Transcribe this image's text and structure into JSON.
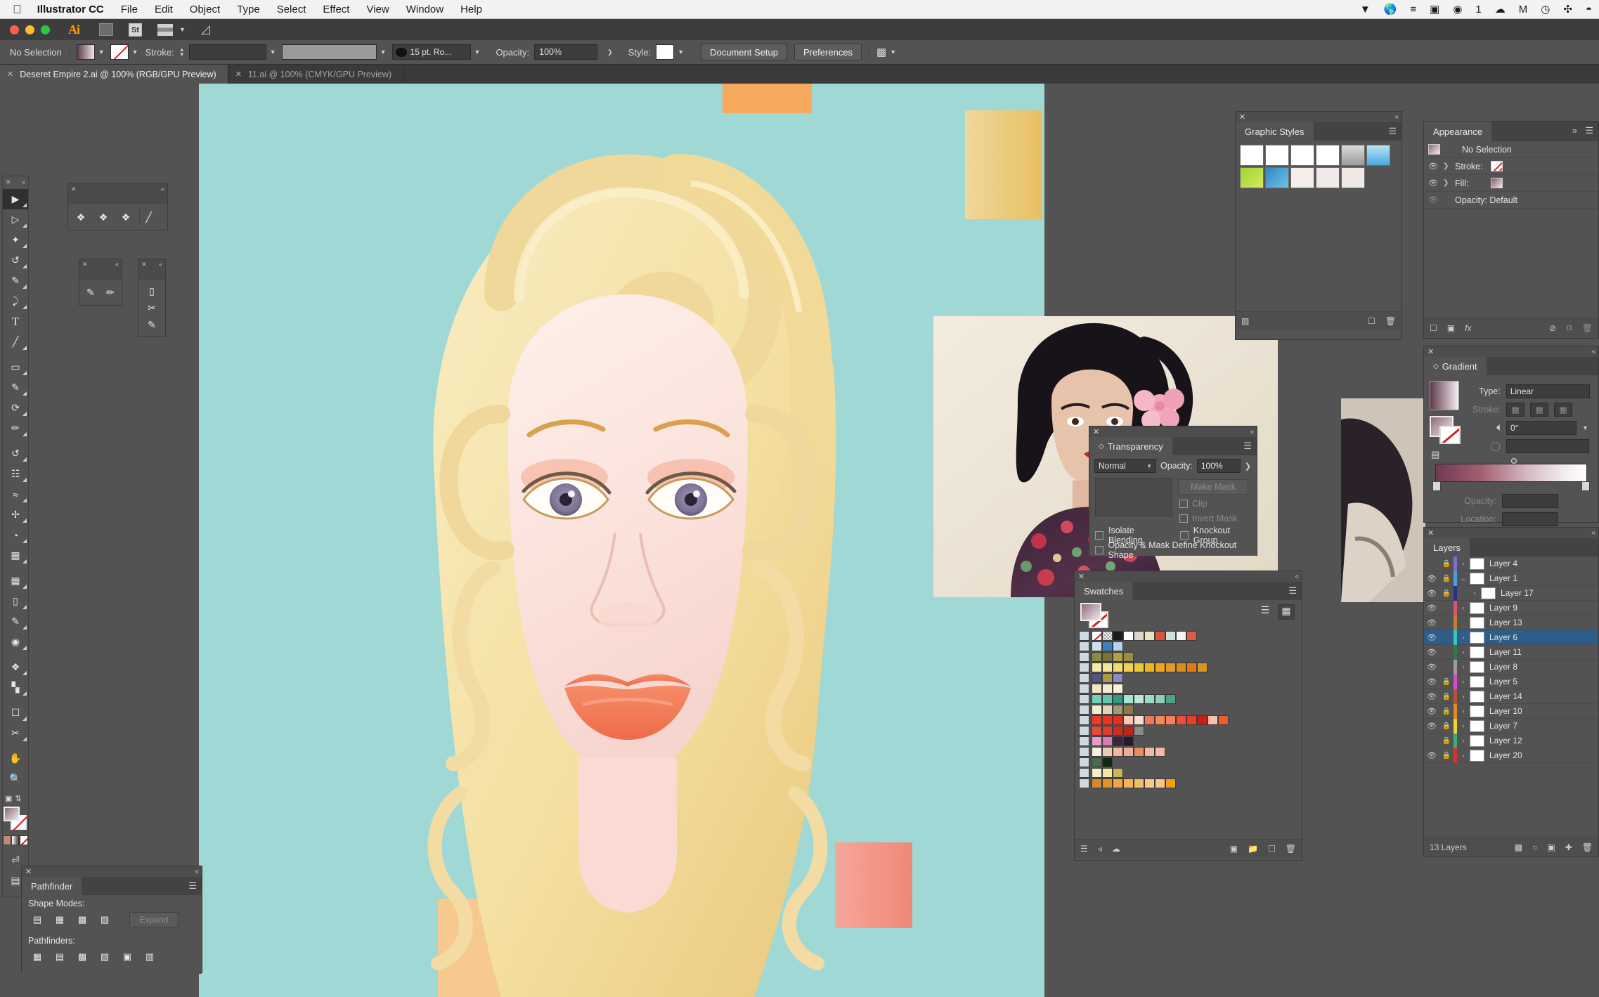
{
  "menubar": {
    "apple": "",
    "app_name": "Illustrator CC",
    "items": [
      "File",
      "Edit",
      "Object",
      "Type",
      "Select",
      "Effect",
      "View",
      "Window",
      "Help"
    ],
    "status_items": [
      "dropbox-icon",
      "globe-icon",
      "list-icon",
      "display-icon",
      "chat-icon",
      "1",
      "cloud-icon",
      "m-icon",
      "clock-icon",
      "bluetooth-icon",
      "wifi-icon"
    ],
    "chat_count": "1"
  },
  "appbar": {
    "logo": "Ai",
    "icons": [
      "bridge-icon",
      "stock-icon",
      "arrange-documents-icon",
      "chevron-down-icon",
      "workspace-icon"
    ]
  },
  "controlbar": {
    "selection_status": "No Selection",
    "fill_label": "fill-swatch",
    "stroke_swatch_label": "stroke-swatch",
    "stroke_label": "Stroke:",
    "stroke_weight": "",
    "stroke_profile": "",
    "brush_label": "15 pt. Ro...",
    "opacity_label": "Opacity:",
    "opacity_value": "100%",
    "style_label": "Style:",
    "document_setup": "Document Setup",
    "preferences": "Preferences",
    "align_label": "align-icon"
  },
  "tabs": [
    {
      "label": "Deseret Empire 2.ai @ 100% (RGB/GPU Preview)",
      "active": true
    },
    {
      "label": "11.ai @ 100% (CMYK/GPU Preview)",
      "active": false
    }
  ],
  "toolbar": {
    "tools": [
      "selection-tool",
      "direct-selection-tool",
      "magic-wand-tool",
      "lasso-tool",
      "pen-tool",
      "curvature-tool",
      "type-tool",
      "line-segment-tool",
      "rectangle-tool",
      "paintbrush-tool",
      "shaper-tool",
      "pencil-tool",
      "blob-brush-tool",
      "eraser-tool",
      "rotate-tool",
      "scale-tool",
      "width-tool",
      "free-transform-tool",
      "shape-builder-tool",
      "perspective-grid-tool",
      "mesh-tool",
      "gradient-tool",
      "eyedropper-tool",
      "blend-tool",
      "symbol-sprayer-tool",
      "column-graph-tool",
      "artboard-tool",
      "slice-tool",
      "hand-tool",
      "zoom-tool"
    ],
    "fill_stroke": "fill-stroke-swatches",
    "color_modes": [
      "color-mode",
      "gradient-mode",
      "none-mode"
    ]
  },
  "mini_panels": [
    {
      "name": "symbolism-tools",
      "buttons": [
        "symbol-sprayer",
        "symbol-shifter",
        "symbol-scruncher",
        "symbol-sizer"
      ]
    },
    {
      "name": "brush-tools",
      "buttons": [
        "paintbrush",
        "blob-brush"
      ]
    },
    {
      "name": "eraser-tools",
      "buttons": [
        "eraser",
        "scissors",
        "knife"
      ]
    }
  ],
  "graphic_styles": {
    "title": "Graphic Styles",
    "swatch_count": 12,
    "footer_icons": [
      "break-link-icon",
      "new-style-icon",
      "delete-icon"
    ]
  },
  "appearance": {
    "title": "Appearance",
    "target": "No Selection",
    "rows": [
      {
        "label": "Stroke:",
        "eye": true,
        "arrow": true,
        "swatch": "none"
      },
      {
        "label": "Fill:",
        "eye": true,
        "arrow": true,
        "swatch": "gradient"
      }
    ],
    "opacity_row": "Opacity: Default",
    "footer_icons": [
      "add-new-stroke-icon",
      "add-new-fill-icon",
      "add-effect-icon",
      "clear-appearance-icon",
      "duplicate-item-icon",
      "delete-item-icon"
    ]
  },
  "gradient": {
    "title": "Gradient",
    "type_label": "Type:",
    "type_value": "Linear",
    "stroke_label": "Stroke:",
    "angle_label": "angle-icon",
    "angle_value": "0°",
    "aspect_label": "aspect-ratio-icon",
    "aspect_value": "",
    "opacity_label": "Opacity:",
    "opacity_value": "",
    "location_label": "Location:",
    "location_value": "",
    "stops": [
      "#6d3a52",
      "#ffffff"
    ]
  },
  "layers_panel": {
    "title": "Layers",
    "count_label": "13 Layers",
    "footer_icons": [
      "make-clipping-mask-icon",
      "create-new-sublayer-icon",
      "locate-object-icon",
      "create-new-layer-icon",
      "delete-selection-icon"
    ],
    "layers": [
      {
        "name": "Layer 4",
        "visible": false,
        "locked": true,
        "arrow": true,
        "color": "#7b6fd1",
        "selected": false,
        "indent": 0
      },
      {
        "name": "Layer 1",
        "visible": true,
        "locked": true,
        "arrow": true,
        "color": "#4a9fd4",
        "selected": false,
        "indent": 0,
        "expanded": true
      },
      {
        "name": "Layer 17",
        "visible": true,
        "locked": true,
        "arrow": true,
        "color": "#2b2f8a",
        "selected": false,
        "indent": 1
      },
      {
        "name": "Layer 9",
        "visible": true,
        "locked": false,
        "arrow": true,
        "color": "#d9556a",
        "selected": false,
        "indent": 0
      },
      {
        "name": "Layer 13",
        "visible": true,
        "locked": false,
        "arrow": false,
        "color": "#c87a3d",
        "selected": false,
        "indent": 0
      },
      {
        "name": "Layer 6",
        "visible": true,
        "locked": false,
        "arrow": true,
        "color": "#36c7b8",
        "selected": true,
        "indent": 0
      },
      {
        "name": "Layer 11",
        "visible": true,
        "locked": false,
        "arrow": true,
        "color": "#2f7a3c",
        "selected": false,
        "indent": 0
      },
      {
        "name": "Layer 8",
        "visible": true,
        "locked": false,
        "arrow": true,
        "color": "#9d9d9d",
        "selected": false,
        "indent": 0
      },
      {
        "name": "Layer 5",
        "visible": true,
        "locked": true,
        "arrow": true,
        "color": "#d64bd6",
        "selected": false,
        "indent": 0
      },
      {
        "name": "Layer 14",
        "visible": true,
        "locked": true,
        "arrow": true,
        "color": "#b4553a",
        "selected": false,
        "indent": 0
      },
      {
        "name": "Layer 10",
        "visible": true,
        "locked": true,
        "arrow": true,
        "color": "#e08a28",
        "selected": false,
        "indent": 0
      },
      {
        "name": "Layer 7",
        "visible": true,
        "locked": true,
        "arrow": true,
        "color": "#e6d63a",
        "selected": false,
        "indent": 0
      },
      {
        "name": "Layer 12",
        "visible": false,
        "locked": true,
        "arrow": true,
        "color": "#3fa97a",
        "selected": false,
        "indent": 0
      },
      {
        "name": "Layer 20",
        "visible": true,
        "locked": true,
        "arrow": true,
        "color": "#d43333",
        "selected": false,
        "indent": 0
      }
    ]
  },
  "transparency": {
    "title": "Transparency",
    "blend_mode": "Normal",
    "opacity_label": "Opacity:",
    "opacity_value": "100%",
    "make_mask": "Make Mask",
    "clip": "Clip",
    "invert_mask": "Invert Mask",
    "isolate_blending": "Isolate Blending",
    "knockout_group": "Knockout Group",
    "opacity_mask_knockout": "Opacity & Mask Define Knockout Shape"
  },
  "swatches": {
    "title": "Swatches",
    "view_list_icon": "list-view-icon",
    "view_grid_icon": "grid-view-icon",
    "footer_icons": [
      "swatch-libraries-icon",
      "show-kinds-icon",
      "color-group-icon",
      "options-icon",
      "new-color-group-icon",
      "new-swatch-icon",
      "delete-swatch-icon"
    ],
    "rows": [
      [
        "none",
        "registration",
        "#1b1b1b",
        "#fdfcfa",
        "#e0d6c5",
        "#ebe0c0",
        "#d9543c",
        "#cfe0d8",
        "#f4f4f0",
        "#e05a46"
      ],
      [
        "#cfe0ea",
        "#3f7fbf",
        "#b6d4ee"
      ],
      [
        "#8b8b3c",
        "#7a7535",
        "#b0a047",
        "#9a8f3e"
      ],
      [
        "#f6e9a8",
        "#f5e490",
        "#f3dc72",
        "#f0d250",
        "#eec935",
        "#f0b51e",
        "#f3a51b",
        "#e09a25",
        "#dc8c1c",
        "#e07b14",
        "#d99520"
      ],
      [
        "#56557e",
        "#a99b4a",
        "#8a8cc4"
      ],
      [
        "#f4e7c4",
        "#f7ead3",
        "#faf2de"
      ],
      [
        "#6fd3b9",
        "#5ec7a8",
        "#2f9c7f",
        "#a8e4cf",
        "#bde8d9",
        "#9ddbc8",
        "#8cd0bb",
        "#4f9e86"
      ],
      [
        "#f4efd3",
        "#ded5b4",
        "#9f9a7c",
        "#8a7c4a"
      ],
      [
        "#ef3a2a",
        "#ee3324",
        "#ec2c1d",
        "#f6c9b6",
        "#f9ded0",
        "#f2765a",
        "#f08a5a",
        "#f2805c",
        "#ee4f3a",
        "#ec3b28",
        "#c71f15",
        "#f5c0ae",
        "#ee5b2c"
      ],
      [
        "#e84a3a",
        "#e03b2c",
        "#cc2d22",
        "#b8261c",
        "#8a8a8a"
      ],
      [
        "#e89ac9",
        "#d87ab3",
        "#3d2340",
        "#2a182c"
      ],
      [
        "#f8efdf",
        "#f0c9b4",
        "#eeb99f",
        "#eeae96",
        "#e88a62",
        "#f2b5a0",
        "#f2bba6"
      ],
      [
        "#4a6b4a",
        "#0f2a13"
      ],
      [
        "#f6efc8",
        "#f3e7a8",
        "#c8b85c"
      ],
      [
        "#d98a28",
        "#e09428",
        "#eda643",
        "#f0b35c",
        "#f3bd6e",
        "#f5c98a",
        "#f0c88c",
        "#f59d14"
      ]
    ]
  },
  "pathfinder": {
    "title": "Pathfinder",
    "shape_modes_label": "Shape Modes:",
    "shape_modes": [
      "unite-icon",
      "minus-front-icon",
      "intersect-icon",
      "exclude-icon"
    ],
    "expand_label": "Expand",
    "pathfinders_label": "Pathfinders:",
    "pathfinders": [
      "divide-icon",
      "trim-icon",
      "merge-icon",
      "crop-icon",
      "outline-icon",
      "minus-back-icon"
    ]
  },
  "artwork": {
    "name": "vintage-pinup-vector-portrait",
    "background_color": "#9fd8d4",
    "hair_color": "#f5e0a4",
    "skin_color": "#fbe5df",
    "lip_color": "#f4805e",
    "accent_rects": [
      "#f7a95c",
      "#ecc87a",
      "#f08a7a"
    ]
  }
}
